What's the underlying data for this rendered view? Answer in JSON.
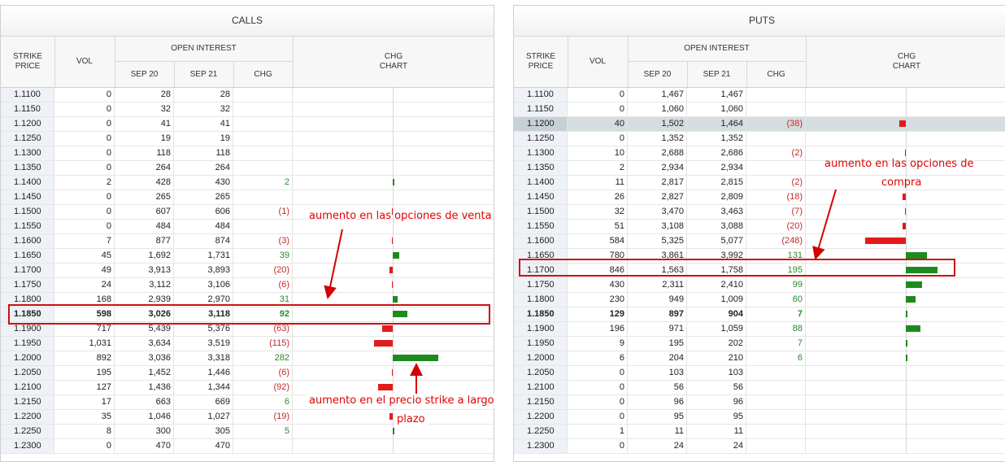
{
  "colors": {
    "positive": "#1e8a1e",
    "negative": "#e31b1b",
    "annotation": "#e00000",
    "box": "#cc1010"
  },
  "header": {
    "strike": "STRIKE PRICE",
    "vol": "VOL",
    "open_interest": "OPEN INTEREST",
    "sep20": "SEP 20",
    "sep21": "SEP 21",
    "chg": "CHG",
    "chart": "CHG CHART"
  },
  "calls": {
    "title": "CALLS",
    "rows": [
      {
        "strike": "1.1100",
        "vol": "0",
        "sep20": "28",
        "sep21": "28",
        "chg": "",
        "bar": 0
      },
      {
        "strike": "1.1150",
        "vol": "0",
        "sep20": "32",
        "sep21": "32",
        "chg": "",
        "bar": 0
      },
      {
        "strike": "1.1200",
        "vol": "0",
        "sep20": "41",
        "sep21": "41",
        "chg": "",
        "bar": 0
      },
      {
        "strike": "1.1250",
        "vol": "0",
        "sep20": "19",
        "sep21": "19",
        "chg": "",
        "bar": 0
      },
      {
        "strike": "1.1300",
        "vol": "0",
        "sep20": "118",
        "sep21": "118",
        "chg": "",
        "bar": 0
      },
      {
        "strike": "1.1350",
        "vol": "0",
        "sep20": "264",
        "sep21": "264",
        "chg": "",
        "bar": 0
      },
      {
        "strike": "1.1400",
        "vol": "2",
        "sep20": "428",
        "sep21": "430",
        "chg": "2",
        "bar": 2
      },
      {
        "strike": "1.1450",
        "vol": "0",
        "sep20": "265",
        "sep21": "265",
        "chg": "",
        "bar": 0
      },
      {
        "strike": "1.1500",
        "vol": "0",
        "sep20": "607",
        "sep21": "606",
        "chg": "(1)",
        "bar": -1
      },
      {
        "strike": "1.1550",
        "vol": "0",
        "sep20": "484",
        "sep21": "484",
        "chg": "",
        "bar": 0
      },
      {
        "strike": "1.1600",
        "vol": "7",
        "sep20": "877",
        "sep21": "874",
        "chg": "(3)",
        "bar": -3
      },
      {
        "strike": "1.1650",
        "vol": "45",
        "sep20": "1,692",
        "sep21": "1,731",
        "chg": "39",
        "bar": 39
      },
      {
        "strike": "1.1700",
        "vol": "49",
        "sep20": "3,913",
        "sep21": "3,893",
        "chg": "(20)",
        "bar": -20
      },
      {
        "strike": "1.1750",
        "vol": "24",
        "sep20": "3,112",
        "sep21": "3,106",
        "chg": "(6)",
        "bar": -6
      },
      {
        "strike": "1.1800",
        "vol": "168",
        "sep20": "2,939",
        "sep21": "2,970",
        "chg": "31",
        "bar": 31
      },
      {
        "strike": "1.1850",
        "vol": "598",
        "sep20": "3,026",
        "sep21": "3,118",
        "chg": "92",
        "bar": 92,
        "bold": true
      },
      {
        "strike": "1.1900",
        "vol": "717",
        "sep20": "5,439",
        "sep21": "5,376",
        "chg": "(63)",
        "bar": -63
      },
      {
        "strike": "1.1950",
        "vol": "1,031",
        "sep20": "3,634",
        "sep21": "3,519",
        "chg": "(115)",
        "bar": -115
      },
      {
        "strike": "1.2000",
        "vol": "892",
        "sep20": "3,036",
        "sep21": "3,318",
        "chg": "282",
        "bar": 282
      },
      {
        "strike": "1.2050",
        "vol": "195",
        "sep20": "1,452",
        "sep21": "1,446",
        "chg": "(6)",
        "bar": -6
      },
      {
        "strike": "1.2100",
        "vol": "127",
        "sep20": "1,436",
        "sep21": "1,344",
        "chg": "(92)",
        "bar": -92
      },
      {
        "strike": "1.2150",
        "vol": "17",
        "sep20": "663",
        "sep21": "669",
        "chg": "6",
        "bar": 6
      },
      {
        "strike": "1.2200",
        "vol": "35",
        "sep20": "1,046",
        "sep21": "1,027",
        "chg": "(19)",
        "bar": -19
      },
      {
        "strike": "1.2250",
        "vol": "8",
        "sep20": "300",
        "sep21": "305",
        "chg": "5",
        "bar": 5
      },
      {
        "strike": "1.2300",
        "vol": "0",
        "sep20": "470",
        "sep21": "470",
        "chg": "",
        "bar": 0
      }
    ]
  },
  "puts": {
    "title": "PUTS",
    "rows": [
      {
        "strike": "1.1100",
        "vol": "0",
        "sep20": "1,467",
        "sep21": "1,467",
        "chg": "",
        "bar": 0
      },
      {
        "strike": "1.1150",
        "vol": "0",
        "sep20": "1,060",
        "sep21": "1,060",
        "chg": "",
        "bar": 0
      },
      {
        "strike": "1.1200",
        "vol": "40",
        "sep20": "1,502",
        "sep21": "1,464",
        "chg": "(38)",
        "bar": -38,
        "highlight": true
      },
      {
        "strike": "1.1250",
        "vol": "0",
        "sep20": "1,352",
        "sep21": "1,352",
        "chg": "",
        "bar": 0
      },
      {
        "strike": "1.1300",
        "vol": "10",
        "sep20": "2,688",
        "sep21": "2,686",
        "chg": "(2)",
        "bar": -2
      },
      {
        "strike": "1.1350",
        "vol": "2",
        "sep20": "2,934",
        "sep21": "2,934",
        "chg": "",
        "bar": 0
      },
      {
        "strike": "1.1400",
        "vol": "11",
        "sep20": "2,817",
        "sep21": "2,815",
        "chg": "(2)",
        "bar": -2
      },
      {
        "strike": "1.1450",
        "vol": "26",
        "sep20": "2,827",
        "sep21": "2,809",
        "chg": "(18)",
        "bar": -18
      },
      {
        "strike": "1.1500",
        "vol": "32",
        "sep20": "3,470",
        "sep21": "3,463",
        "chg": "(7)",
        "bar": -7
      },
      {
        "strike": "1.1550",
        "vol": "51",
        "sep20": "3,108",
        "sep21": "3,088",
        "chg": "(20)",
        "bar": -20
      },
      {
        "strike": "1.1600",
        "vol": "584",
        "sep20": "5,325",
        "sep21": "5,077",
        "chg": "(248)",
        "bar": -248
      },
      {
        "strike": "1.1650",
        "vol": "780",
        "sep20": "3,861",
        "sep21": "3,992",
        "chg": "131",
        "bar": 131
      },
      {
        "strike": "1.1700",
        "vol": "846",
        "sep20": "1,563",
        "sep21": "1,758",
        "chg": "195",
        "bar": 195
      },
      {
        "strike": "1.1750",
        "vol": "430",
        "sep20": "2,311",
        "sep21": "2,410",
        "chg": "99",
        "bar": 99
      },
      {
        "strike": "1.1800",
        "vol": "230",
        "sep20": "949",
        "sep21": "1,009",
        "chg": "60",
        "bar": 60
      },
      {
        "strike": "1.1850",
        "vol": "129",
        "sep20": "897",
        "sep21": "904",
        "chg": "7",
        "bar": 7,
        "bold": true
      },
      {
        "strike": "1.1900",
        "vol": "196",
        "sep20": "971",
        "sep21": "1,059",
        "chg": "88",
        "bar": 88
      },
      {
        "strike": "1.1950",
        "vol": "9",
        "sep20": "195",
        "sep21": "202",
        "chg": "7",
        "bar": 7
      },
      {
        "strike": "1.2000",
        "vol": "6",
        "sep20": "204",
        "sep21": "210",
        "chg": "6",
        "bar": 6
      },
      {
        "strike": "1.2050",
        "vol": "0",
        "sep20": "103",
        "sep21": "103",
        "chg": "",
        "bar": 0
      },
      {
        "strike": "1.2100",
        "vol": "0",
        "sep20": "56",
        "sep21": "56",
        "chg": "",
        "bar": 0
      },
      {
        "strike": "1.2150",
        "vol": "0",
        "sep20": "96",
        "sep21": "96",
        "chg": "",
        "bar": 0
      },
      {
        "strike": "1.2200",
        "vol": "0",
        "sep20": "95",
        "sep21": "95",
        "chg": "",
        "bar": 0
      },
      {
        "strike": "1.2250",
        "vol": "1",
        "sep20": "11",
        "sep21": "11",
        "chg": "",
        "bar": 0
      },
      {
        "strike": "1.2300",
        "vol": "0",
        "sep20": "24",
        "sep21": "24",
        "chg": "",
        "bar": 0
      }
    ]
  },
  "annotations": {
    "sell": "aumento en las opciones de venta",
    "buy_line1": "aumento en las opciones de",
    "buy_line2": "compra",
    "strike_line1": "aumento en el precio strike a largo",
    "strike_line2": "plazo"
  }
}
